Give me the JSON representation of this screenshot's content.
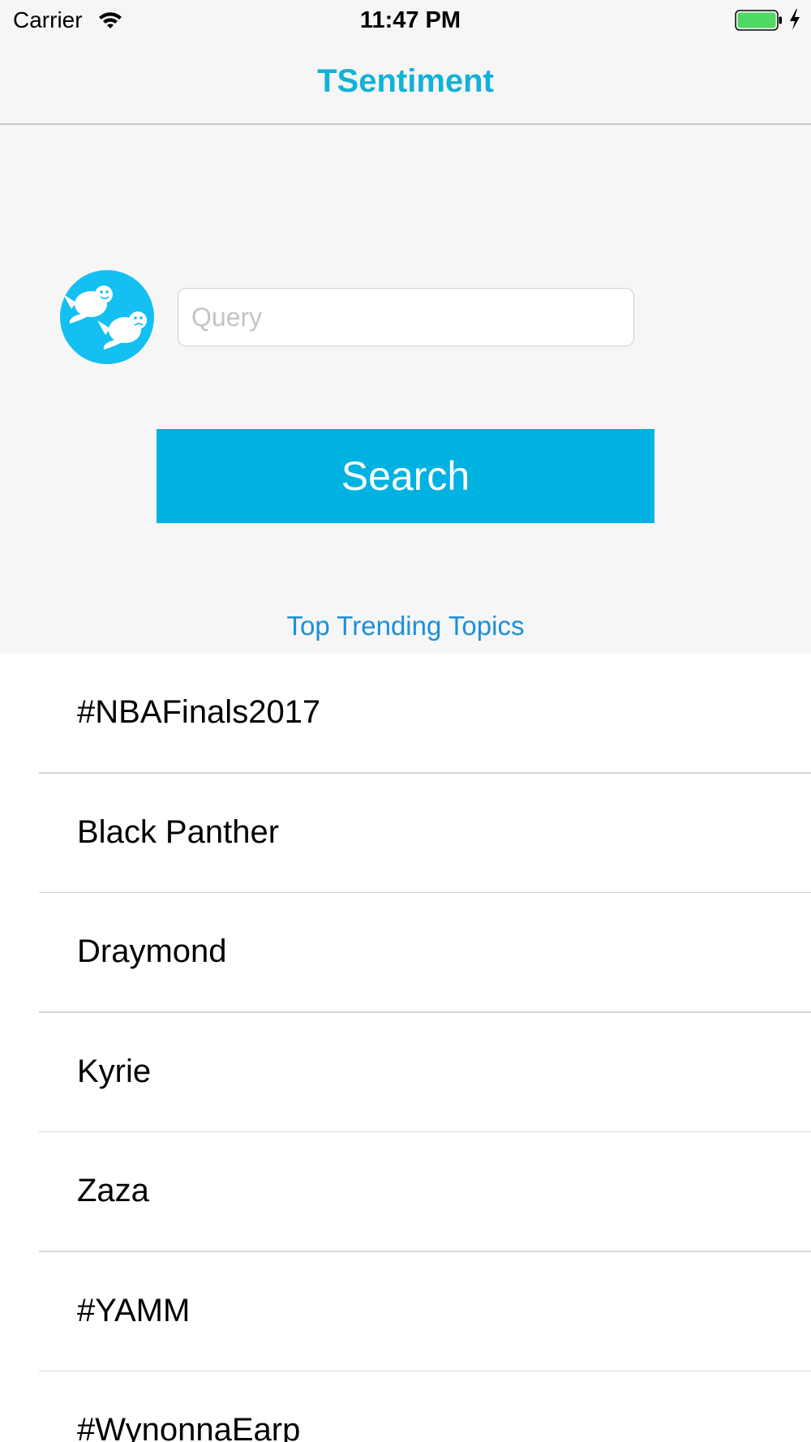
{
  "status_bar": {
    "carrier": "Carrier",
    "time": "11:47 PM",
    "icons": [
      "wifi-icon",
      "battery-icon",
      "charging-bolt-icon"
    ],
    "battery_color": "#4cd964"
  },
  "nav": {
    "title": "TSentiment"
  },
  "search": {
    "logo_icon": "twitter-birds-logo-icon",
    "placeholder": "Query",
    "button_label": "Search"
  },
  "trending": {
    "title": "Top Trending Topics",
    "items": [
      "#NBAFinals2017",
      "Black Panther",
      "Draymond",
      "Kyrie",
      "Zaza",
      "#YAMM",
      "#WynonnaEarp"
    ]
  },
  "colors": {
    "accent": "#12b1d9",
    "button": "#00b2e1",
    "link": "#1d8fd9",
    "logo_background": "#14bff2"
  }
}
